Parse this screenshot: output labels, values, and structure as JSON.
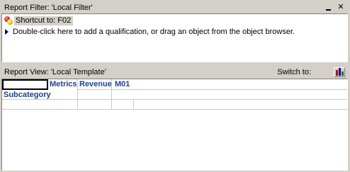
{
  "filter_pane": {
    "title": "Report Filter: 'Local Filter'",
    "minimize_icon": "minimize-icon",
    "close_icon": "close-icon",
    "close_glyph": "✕",
    "shortcut_label": "Shortcut to: F02",
    "hint": "Double-click here to add a qualification, or drag an object from the object browser."
  },
  "view_pane": {
    "title": "Report View: 'Local Template'",
    "switch_label": "Switch to:",
    "switch_icon": "bar-chart-icon"
  },
  "grid": {
    "column_headers": [
      "Metrics",
      "Revenue",
      "M01"
    ],
    "row_header": "Subcategory"
  },
  "colors": {
    "header_text": "#1f3f8f",
    "chrome": "#d4d0c8"
  }
}
